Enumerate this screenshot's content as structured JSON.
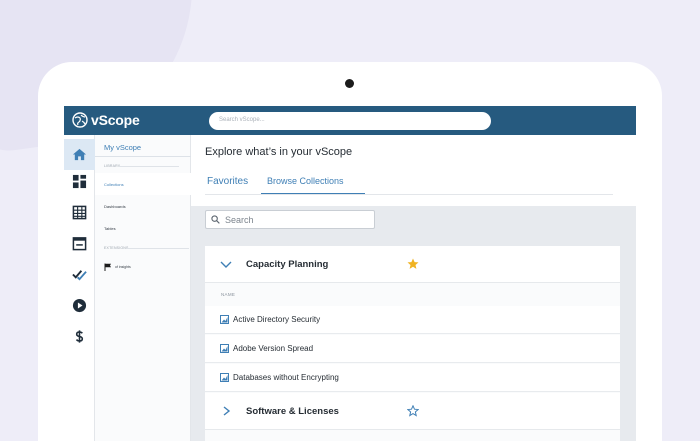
{
  "app": {
    "name": "vScope",
    "search_placeholder": "Search vScope..."
  },
  "iconbar": {
    "items": [
      {
        "icon": "home-icon",
        "active": true
      },
      {
        "icon": "dashboard-icon",
        "active": false
      },
      {
        "icon": "table-icon",
        "active": false
      },
      {
        "icon": "calendar-icon",
        "active": false
      },
      {
        "icon": "checklist-icon",
        "active": false
      },
      {
        "icon": "play-icon",
        "active": false
      },
      {
        "icon": "dollar-icon",
        "active": false
      }
    ]
  },
  "subnav": {
    "title": "My vScope",
    "section_library": "LIBRARY",
    "items": [
      "Collections",
      "Dashboards",
      "Tables"
    ],
    "section_extensions": "EXTENSIONS",
    "insight_label": "of insights"
  },
  "main": {
    "title": "Explore what’s in your vScope",
    "tabs": [
      "Favorites",
      "Browse Collections"
    ],
    "search_placeholder": "Search",
    "groups": [
      {
        "title": "Capacity Planning",
        "expanded": true,
        "favorite": true
      },
      {
        "title": "Software & Licenses",
        "expanded": false,
        "favorite": false
      }
    ],
    "name_header": "NAME",
    "items": [
      "Active Directory Security",
      "Adobe Version Spread",
      "Databases without Encrypting"
    ]
  },
  "colors": {
    "topbar": "#265a7f",
    "accent": "#3f7fb5",
    "star_filled": "#f0b323",
    "icon": "#1f2d3a",
    "background": "#eeedf8"
  }
}
